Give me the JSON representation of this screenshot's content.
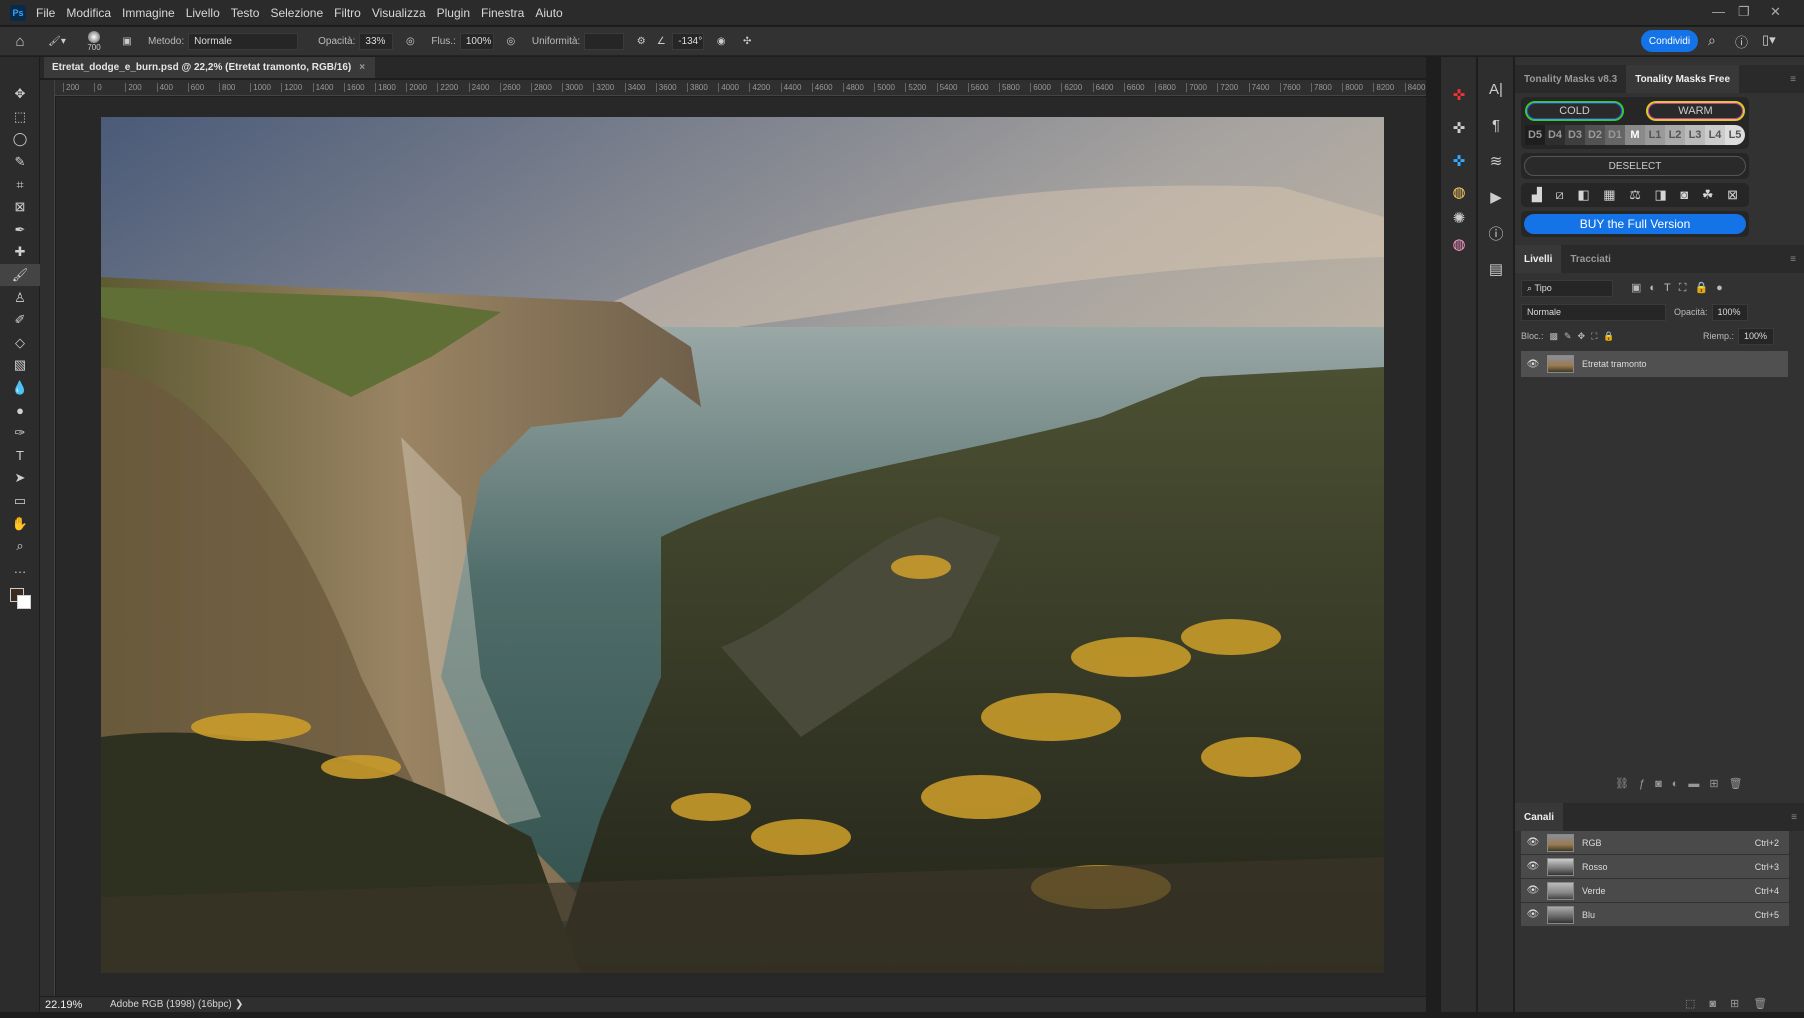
{
  "app": {
    "logo": "Ps",
    "menu": [
      "File",
      "Modifica",
      "Immagine",
      "Livello",
      "Testo",
      "Selezione",
      "Filtro",
      "Visualizza",
      "Plugin",
      "Finestra",
      "Aiuto"
    ]
  },
  "options": {
    "brush_size": "700",
    "method_label": "Metodo:",
    "method_value": "Normale",
    "opacity_label": "Opacità:",
    "opacity_value": "33%",
    "flow_label": "Flus.:",
    "flow_value": "100%",
    "smoothing_label": "Uniformità:",
    "smoothing_value": "",
    "angle_value": "-134°",
    "share_label": "Condividi"
  },
  "document": {
    "tab_title": "Etretat_dodge_e_burn.psd @ 22,2% (Etretat tramonto, RGB/16)",
    "close": "×"
  },
  "ruler": {
    "ticks": [
      "200",
      "0",
      "200",
      "400",
      "600",
      "800",
      "1000",
      "1200",
      "1400",
      "1600",
      "1800",
      "2000",
      "2200",
      "2400",
      "2600",
      "2800",
      "3000",
      "3200",
      "3400",
      "3600",
      "3800",
      "4000",
      "4200",
      "4400",
      "4600",
      "4800",
      "5000",
      "5200",
      "5400",
      "5600",
      "5800",
      "6000",
      "6200",
      "6400",
      "6600",
      "6800",
      "7000",
      "7200",
      "7400",
      "7600",
      "7800",
      "8000",
      "8200",
      "8400"
    ]
  },
  "status": {
    "zoom": "22.19%",
    "profile": "Adobe RGB (1998) (16bpc)",
    "arrow": "❯"
  },
  "tools": [
    "move-icon",
    "marquee-icon",
    "lasso-icon",
    "quick-select-icon",
    "crop-icon",
    "frame-icon",
    "eyedropper-icon",
    "healing-icon",
    "brush-icon",
    "stamp-icon",
    "history-brush-icon",
    "eraser-icon",
    "gradient-icon",
    "blur-icon",
    "dodge-icon",
    "pen-icon",
    "type-icon",
    "path-select-icon",
    "rectangle-icon",
    "hand-icon",
    "zoom-icon",
    "more-icon"
  ],
  "tonality": {
    "tabs": [
      "Tonality Masks v8.3",
      "Tonality Masks Free"
    ],
    "active_tab": 1,
    "cold": "COLD",
    "warm": "WARM",
    "levels": [
      "D5",
      "D4",
      "D3",
      "D2",
      "D1",
      "M",
      "L1",
      "L2",
      "L3",
      "L4",
      "L5"
    ],
    "deselect": "DESELECT",
    "buy": "BUY the Full Version",
    "buy_color": "#1473e6"
  },
  "layers": {
    "tabs": [
      "Livelli",
      "Tracciati"
    ],
    "filter": "Tipo",
    "blend": "Normale",
    "opacity_label": "Opacità:",
    "opacity": "100%",
    "lock_label": "Bloc.:",
    "fill_label": "Riemp.:",
    "fill": "100%",
    "items": [
      {
        "name": "Etretat tramonto",
        "visible": true
      }
    ]
  },
  "channels": {
    "tab": "Canali",
    "items": [
      {
        "name": "RGB",
        "shortcut": "Ctrl+2"
      },
      {
        "name": "Rosso",
        "shortcut": "Ctrl+3"
      },
      {
        "name": "Verde",
        "shortcut": "Ctrl+4"
      },
      {
        "name": "Blu",
        "shortcut": "Ctrl+5"
      }
    ]
  }
}
